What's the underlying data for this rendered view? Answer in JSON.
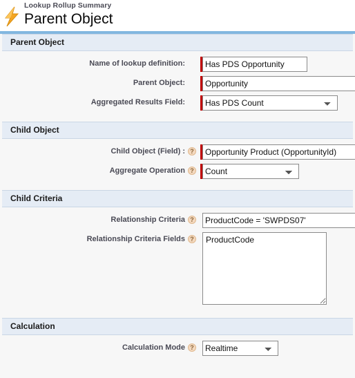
{
  "header": {
    "icon": "lightning-bolt-icon",
    "eyebrow": "Lookup Rollup Summary",
    "title": "Parent Object",
    "rule_color": "#82b7e0",
    "accent_color": "#f5a623"
  },
  "help_glyph": "?",
  "sections": [
    {
      "id": "parent-object",
      "title": "Parent Object",
      "fields": [
        {
          "id": "name-of-lookup-definition",
          "label": "Name of lookup definition:",
          "control": "text",
          "value": "Has PDS Opportunity",
          "placeholder": "",
          "required": true,
          "help": false
        },
        {
          "id": "parent-object",
          "label": "Parent Object:",
          "control": "text",
          "value": "Opportunity",
          "placeholder": "",
          "required": true,
          "help": false
        },
        {
          "id": "aggregated-results-field",
          "label": "Aggregated Results Field:",
          "control": "select",
          "value": "Has PDS Count",
          "options": [
            "Has PDS Count"
          ],
          "required": true,
          "help": false
        }
      ]
    },
    {
      "id": "child-object",
      "title": "Child Object",
      "fields": [
        {
          "id": "child-object-field",
          "label": "Child Object (Field) :",
          "control": "text",
          "value": "Opportunity Product (OpportunityId)",
          "placeholder": "",
          "required": true,
          "help": true
        },
        {
          "id": "aggregate-operation",
          "label": "Aggregate Operation",
          "control": "select",
          "value": "Count",
          "options": [
            "Count"
          ],
          "required": true,
          "help": true
        }
      ]
    },
    {
      "id": "child-criteria",
      "title": "Child Criteria",
      "fields": [
        {
          "id": "relationship-criteria",
          "label": "Relationship Criteria",
          "control": "text",
          "value": "ProductCode = 'SWPDS07'",
          "placeholder": "",
          "required": false,
          "help": true
        },
        {
          "id": "relationship-criteria-fields",
          "label": "Relationship Criteria Fields",
          "control": "textarea",
          "value": "ProductCode",
          "placeholder": "",
          "required": false,
          "help": true
        }
      ]
    },
    {
      "id": "calculation",
      "title": "Calculation",
      "fields": [
        {
          "id": "calculation-mode",
          "label": "Calculation Mode",
          "control": "select",
          "value": "Realtime",
          "options": [
            "Realtime"
          ],
          "required": false,
          "help": true
        }
      ]
    }
  ]
}
